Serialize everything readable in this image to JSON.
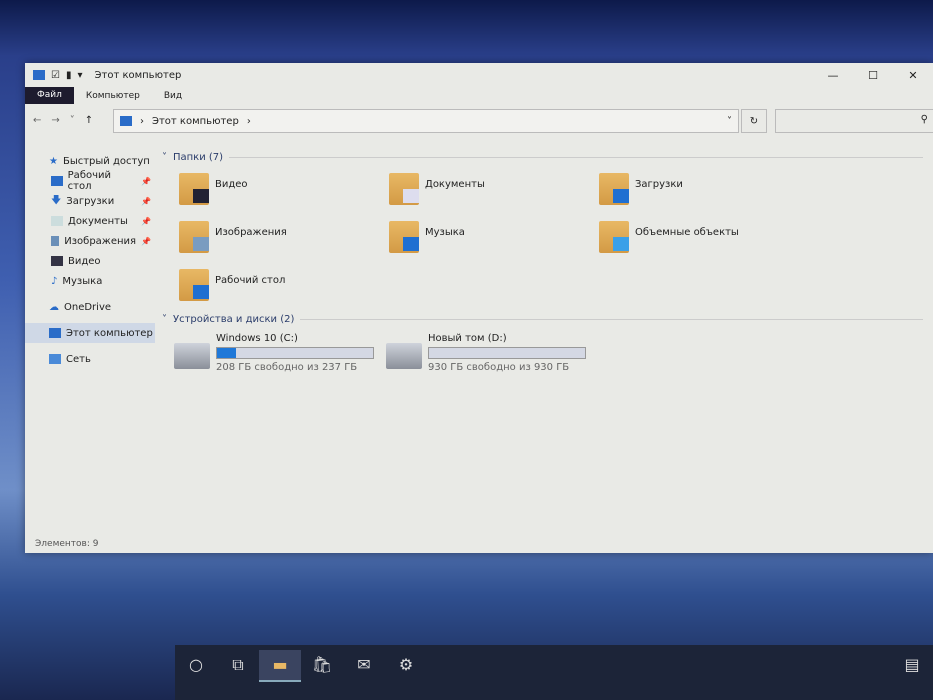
{
  "window": {
    "title": "Этот компьютер",
    "ribbon_tabs": [
      "Файл",
      "Компьютер",
      "Вид"
    ],
    "address": "Этот компьютер",
    "search_placeholder": ""
  },
  "sidebar": {
    "quick_access": "Быстрый доступ",
    "items": [
      "Рабочий стол",
      "Загрузки",
      "Документы",
      "Изображения",
      "Видео",
      "Музыка"
    ],
    "onedrive": "OneDrive",
    "this_pc": "Этот компьютер",
    "network": "Сеть"
  },
  "folders": {
    "header": "Папки (7)",
    "items": [
      "Видео",
      "Документы",
      "Загрузки",
      "Изображения",
      "Музыка",
      "Объемные объекты",
      "Рабочий стол"
    ]
  },
  "drives": {
    "header": "Устройства и диски (2)",
    "items": [
      {
        "name": "Windows 10 (C:)",
        "free": "208 ГБ свободно из 237 ГБ",
        "used_fraction": 0.12
      },
      {
        "name": "Новый том (D:)",
        "free": "930 ГБ свободно из 930 ГБ",
        "used_fraction": 0.0
      }
    ]
  },
  "status": "Элементов: 9"
}
